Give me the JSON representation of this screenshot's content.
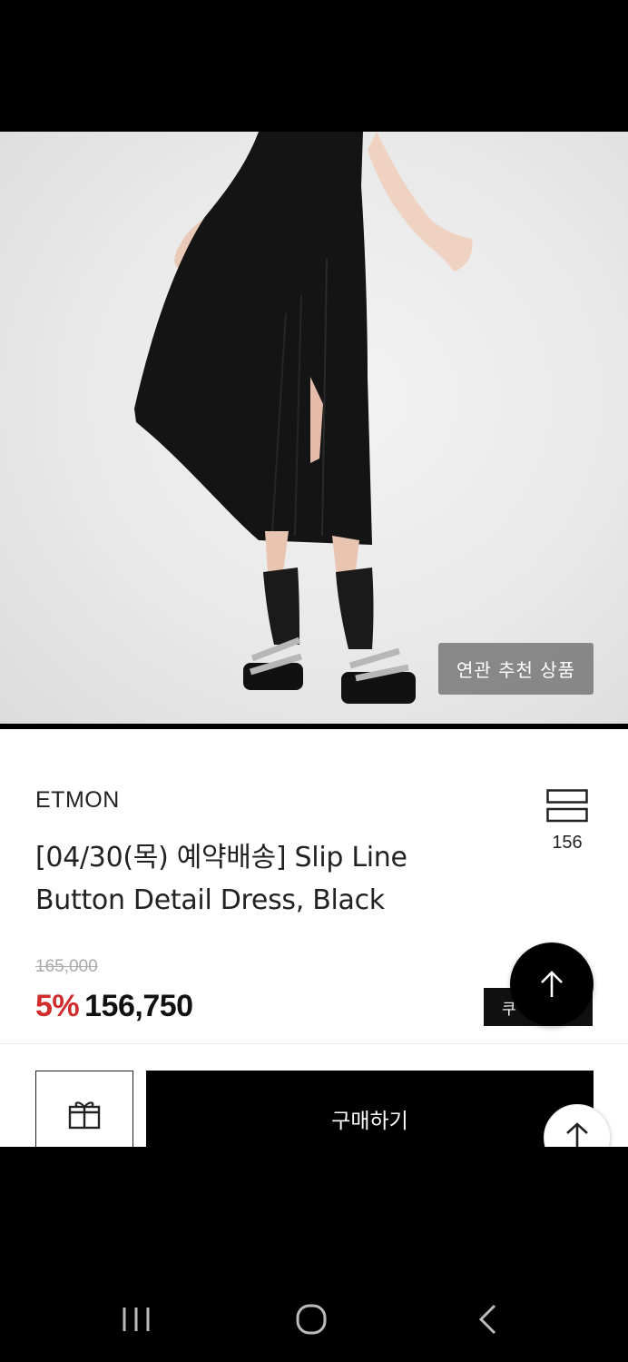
{
  "photo": {
    "related_button_label": "연관 추천 상품"
  },
  "product": {
    "brand": "ETMON",
    "title": "[04/30(목) 예약배송]  Slip Line Button Detail Dress, Black",
    "wish_count": "156",
    "original_price": "165,000",
    "discount": "5%",
    "sale_price": "156,750",
    "coupon_label": "쿠"
  },
  "actions": {
    "buy_label": "구매하기"
  },
  "icons": {
    "wish": "list-icon",
    "gift": "gift-icon",
    "scroll_top": "arrow-up-icon",
    "nav_recent": "recent-apps-icon",
    "nav_home": "home-icon",
    "nav_back": "back-icon"
  },
  "colors": {
    "discount": "#d12b2b",
    "button": "#000000"
  }
}
